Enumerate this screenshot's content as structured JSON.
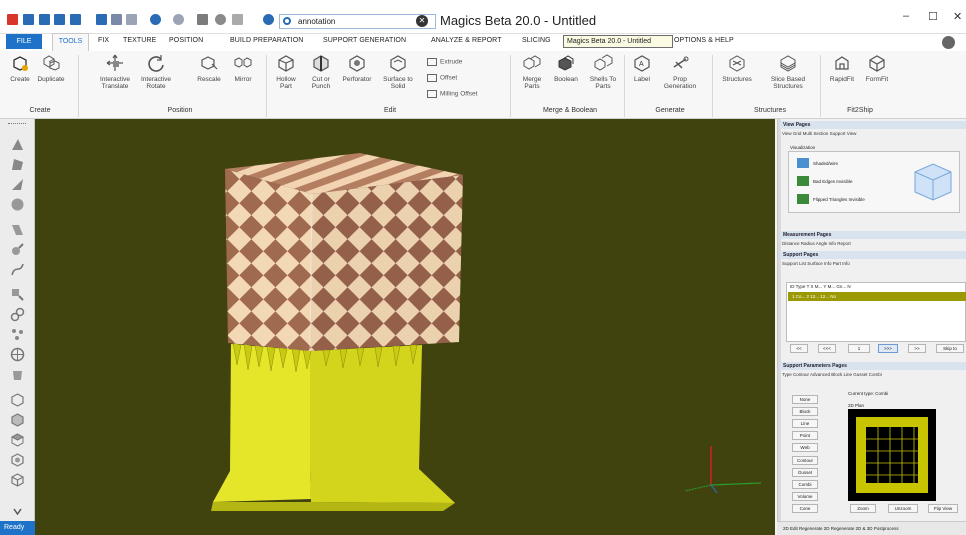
{
  "window": {
    "title": "Magics Beta 20.0 - Untitled",
    "minimize": "–",
    "maximize": "☐",
    "close": "✕"
  },
  "search": {
    "value": "annotation",
    "clear": "✕"
  },
  "tabs": [
    "FILE",
    "TOOLS",
    "FIX",
    "TEXTURE",
    "POSITION",
    "BUILD PREPARATION",
    "SUPPORT GENERATION",
    "ANALYZE & REPORT",
    "SLICING",
    "OPTIONS & HELP"
  ],
  "tooltip": "Magics Beta 20.0 - Untitled",
  "ribbon": {
    "create": {
      "label": "Create",
      "buttons": [
        "Create",
        "Duplicate"
      ]
    },
    "position": {
      "label": "Position",
      "buttons": [
        "Interactive Translate",
        "Interactive Rotate",
        "Rescale",
        "Mirror"
      ]
    },
    "edit": {
      "label": "Edit",
      "buttons": [
        "Hollow Part",
        "Cut or Punch",
        "Perforator",
        "Surface to Solid"
      ],
      "small": [
        "Extrude",
        "Offset",
        "Milling Offset"
      ]
    },
    "merge": {
      "label": "Merge & Boolean",
      "buttons": [
        "Merge Parts",
        "Boolean",
        "Shells To Parts"
      ]
    },
    "generate": {
      "label": "Generate",
      "buttons": [
        "Label",
        "Prop Generation"
      ]
    },
    "structures": {
      "label": "Structures",
      "buttons": [
        "Structures",
        "Slice Based Structures"
      ]
    },
    "fit2ship": {
      "label": "Fit2Ship",
      "buttons": [
        "RapidFit",
        "FormFit"
      ]
    }
  },
  "status": {
    "ready": "Ready"
  },
  "right_panel": {
    "view_pages": {
      "title": "View Pages",
      "tabs": "View   Grid   Multi Section   Support View",
      "visualization": "Visualization",
      "items": [
        "Shaded/wire",
        "Bad Edges Invisible",
        "Flipped Triangles Invisible"
      ]
    },
    "measurement": {
      "title": "Measurement Pages",
      "tabs": "Distance   Radius   Angle   Info   Report"
    },
    "support_pages": {
      "title": "Support Pages",
      "tabs": "Support List   Surface Info   Part Info",
      "columns": "ID   Type   T   X M...   Y M...   Gn...   N",
      "row": "1   Co...   2   12...   12...   No",
      "buttons": [
        "<<",
        "<<<",
        "1",
        ">>>",
        ">>",
        "Skip to"
      ]
    },
    "support_params": {
      "title": "Support Parameters Pages",
      "tabs": "Type   Contour   Advanced   Block   Line   Gusset   Combi",
      "current_type": "Current type:  Combi",
      "plan": "2D Plan",
      "types": [
        "None",
        "Block",
        "Line",
        "Point",
        "Web",
        "Contour",
        "Gusset",
        "Combi",
        "Volume",
        "Cone"
      ],
      "buttons": [
        "Zoom",
        "Unzoom",
        "Flip View"
      ]
    },
    "bottom_tabs": "2D Edit   Regenerate 2D   Regenerate 2D & 3D   Postprocess"
  }
}
